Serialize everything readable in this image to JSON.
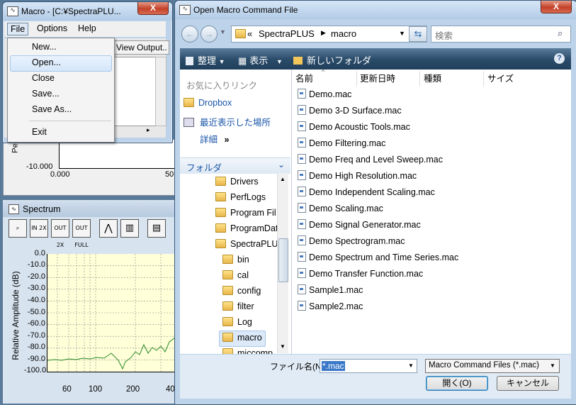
{
  "macro_window": {
    "icon": "waveform-icon",
    "title": "Macro - [C:¥SpectraPLU...",
    "close_label": "X",
    "menu": [
      "File",
      "Options",
      "Help"
    ],
    "view_output": "View Output..",
    "file_menu": [
      "New...",
      "Open...",
      "Close",
      "Save...",
      "Save As...",
      "Exit"
    ]
  },
  "background_plot": {
    "ytick": "-10.000",
    "xtick_start": "0.000",
    "xtick_end": "50",
    "ylabel_fragment": "Pe"
  },
  "spectrum_window": {
    "title": "Spectrum",
    "tools": [
      "zoom-icon",
      "zoom-in-2x-icon",
      "zoom-out-2x-icon",
      "zoom-out-full-icon",
      "peak-icon",
      "bars-icon",
      "settings-icon"
    ],
    "tool_labels": [
      "",
      "IN 2X",
      "OUT 2X",
      "OUT FULL",
      "",
      "",
      ""
    ],
    "ylabel": "Relative Amplitude (dB)",
    "yticks": [
      "0.0",
      "-10.0",
      "-20.0",
      "-30.0",
      "-40.0",
      "-50.0",
      "-60.0",
      "-70.0",
      "-80.0",
      "-90.0",
      "-100.0"
    ],
    "xticks": [
      "60",
      "100",
      "200",
      "40"
    ]
  },
  "dialog": {
    "title": "Open Macro Command File",
    "close_label": "X",
    "breadcrumb": [
      "SpectraPLUS",
      "macro"
    ],
    "breadcrumb_prefix": "«",
    "search_placeholder": "検索",
    "commands": {
      "organize": "整理",
      "views": "表示",
      "new_folder": "新しいフォルダ"
    },
    "favorites_header": "お気に入りリンク",
    "favorites": [
      "Dropbox",
      "最近表示した場所"
    ],
    "more": "詳細",
    "more_arrow": "»",
    "folders_header": "フォルダ",
    "tree_top": [
      "Drivers",
      "PerfLogs",
      "Program Fil",
      "ProgramDat",
      "SpectraPLU"
    ],
    "tree_sub": [
      "bin",
      "cal",
      "config",
      "filter",
      "Log",
      "macro",
      "miccomp"
    ],
    "columns": [
      "名前",
      "更新日時",
      "種類",
      "サイズ"
    ],
    "files": [
      "Demo.mac",
      "Demo 3-D Surface.mac",
      "Demo Acoustic Tools.mac",
      "Demo Filtering.mac",
      "Demo Freq and Level Sweep.mac",
      "Demo High Resolution.mac",
      "Demo Independent Scaling.mac",
      "Demo Scaling.mac",
      "Demo Signal Generator.mac",
      "Demo Spectrogram.mac",
      "Demo Spectrum and Time Series.mac",
      "Demo Transfer Function.mac",
      "Sample1.mac",
      "Sample2.mac"
    ],
    "filename_label": "ファイル名(N):",
    "filename_value": "*.mac",
    "filetype": "Macro Command Files (*.mac)",
    "open_button": "開く(O)",
    "cancel_button": "キャンセル"
  }
}
